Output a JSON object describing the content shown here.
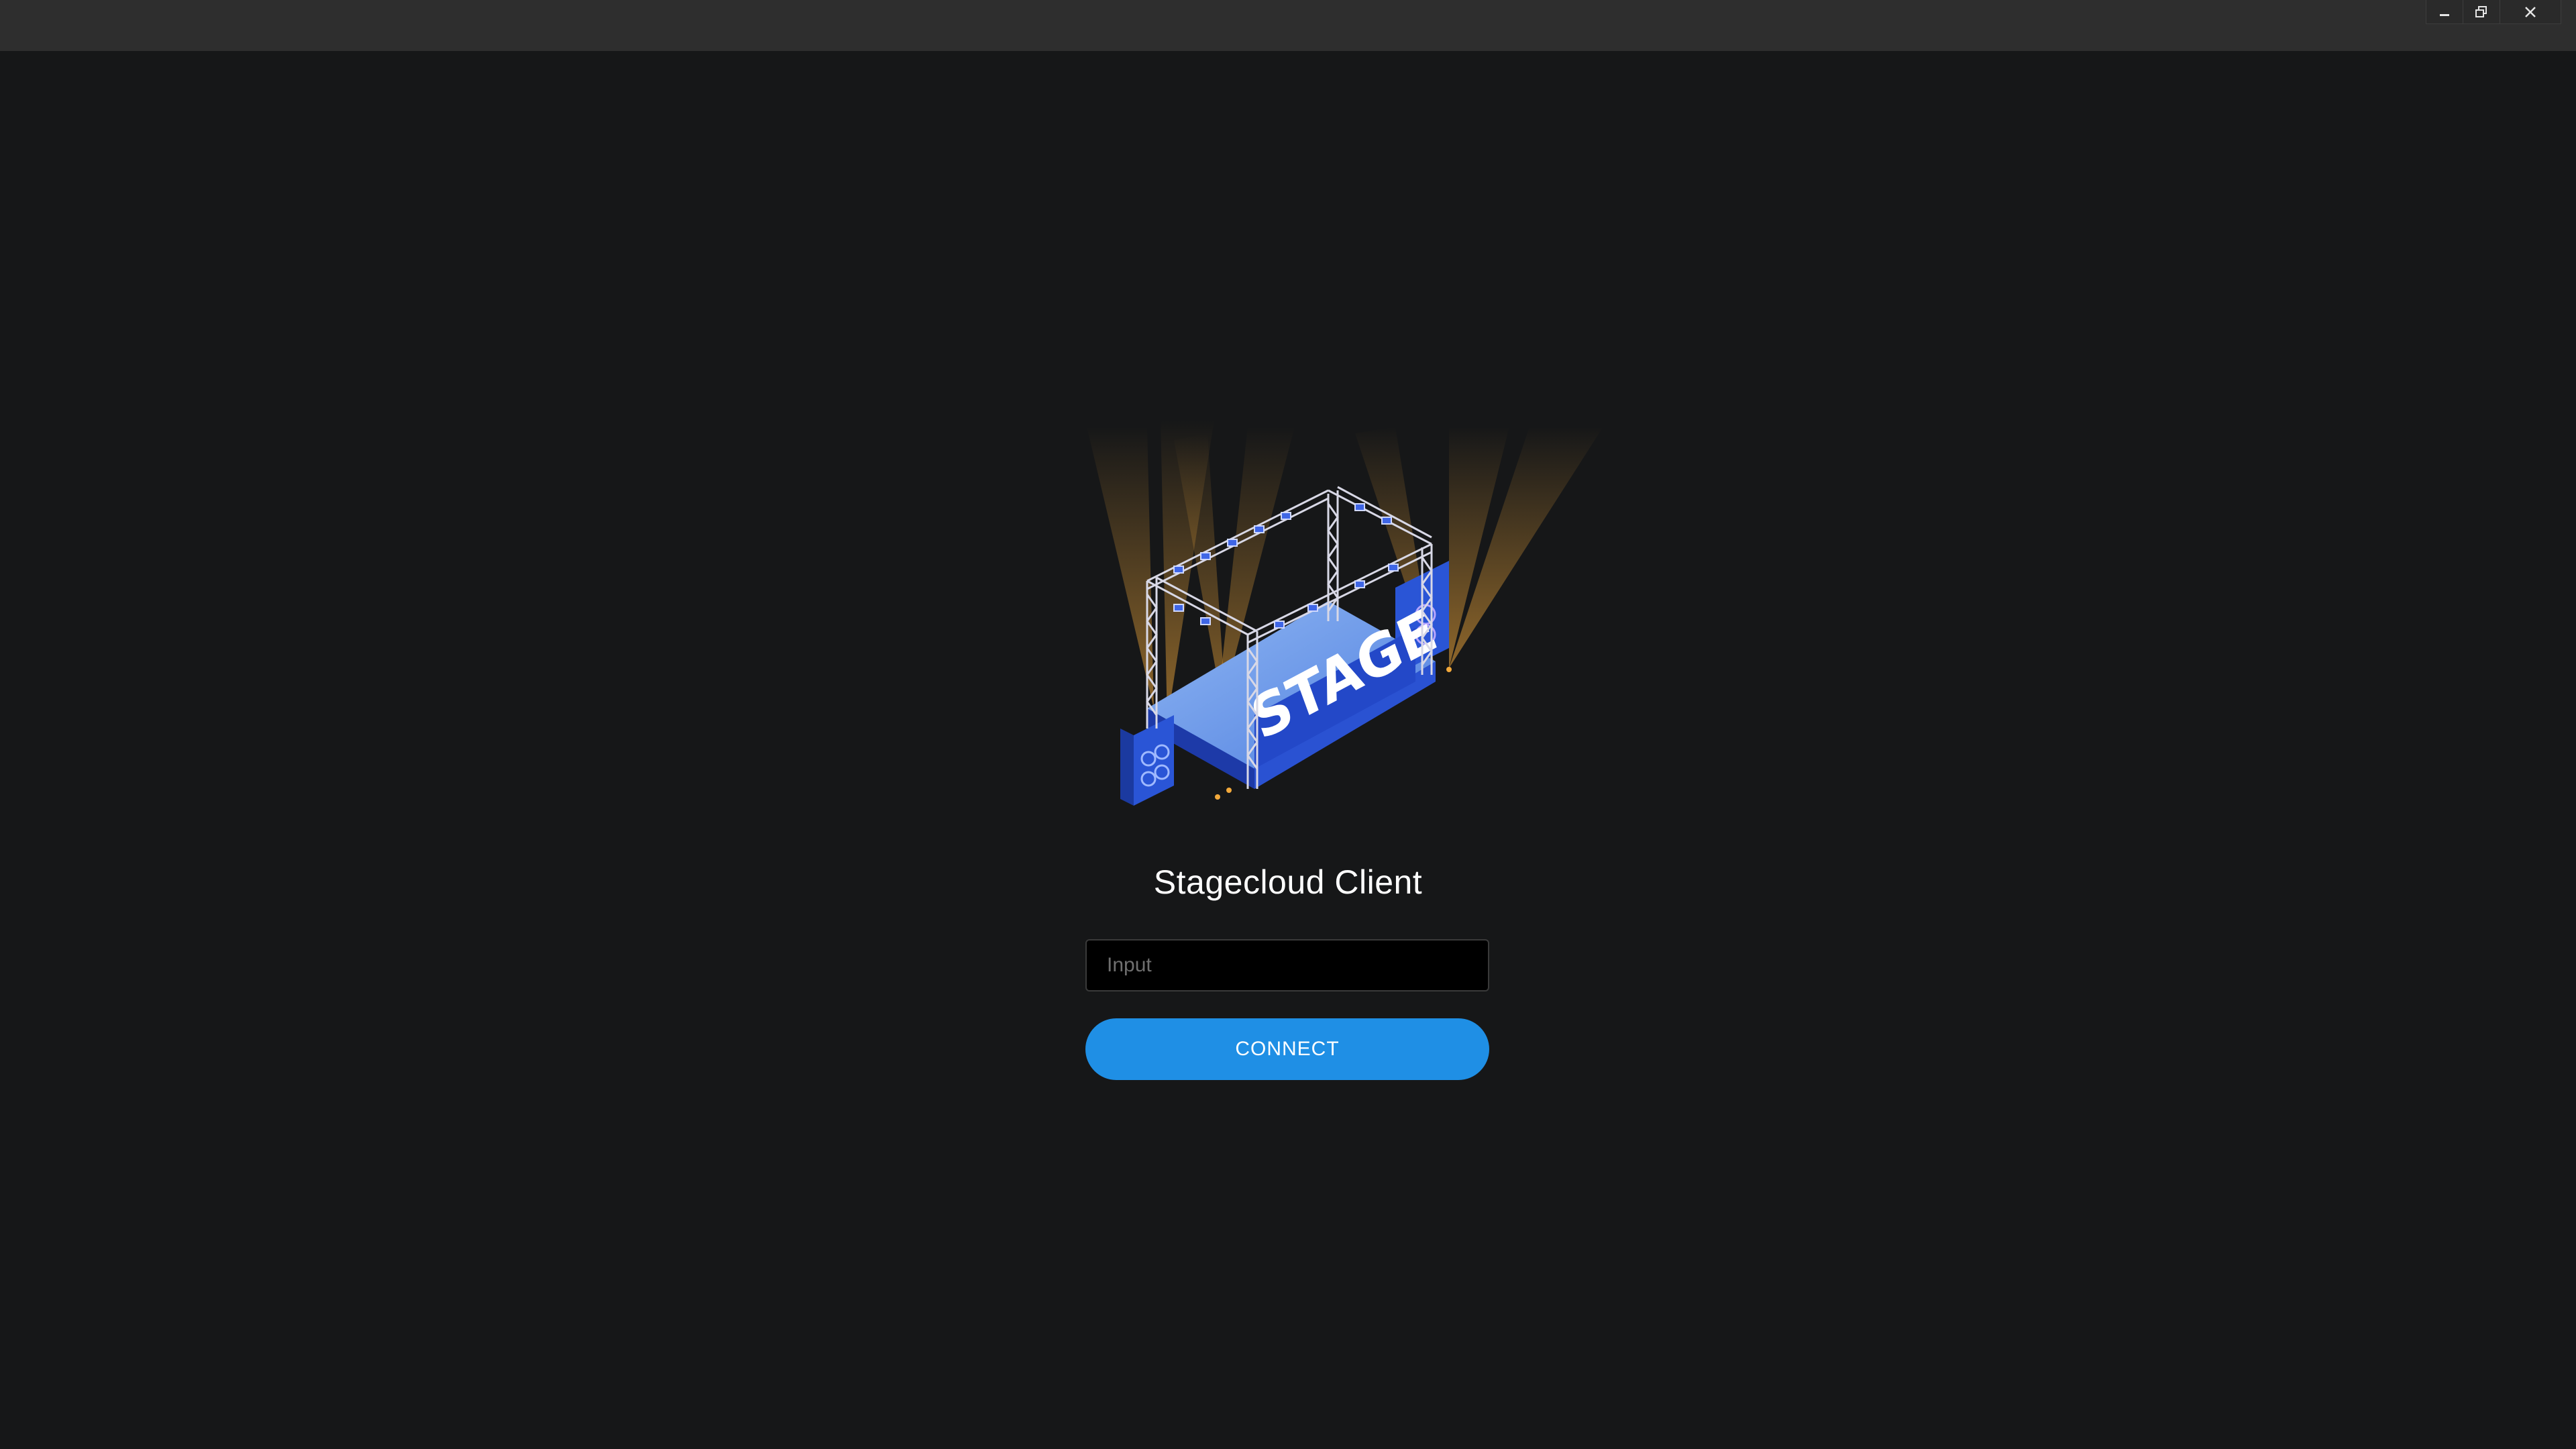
{
  "window": {
    "controls": {
      "minimize_icon": "minimize-icon",
      "restore_icon": "restore-icon",
      "close_icon": "close-icon"
    }
  },
  "app": {
    "title": "Stagecloud Client",
    "illustration_text": "STAGE"
  },
  "connect_form": {
    "input_value": "",
    "input_placeholder": "Input",
    "connect_label": "CONNECT"
  },
  "colors": {
    "background": "#161718",
    "titlebar": "#2e2e2e",
    "accent": "#1f8fe5",
    "input_background": "#000000",
    "stage_blue": "#2b57d9",
    "light_beam": "#f2a93b"
  }
}
